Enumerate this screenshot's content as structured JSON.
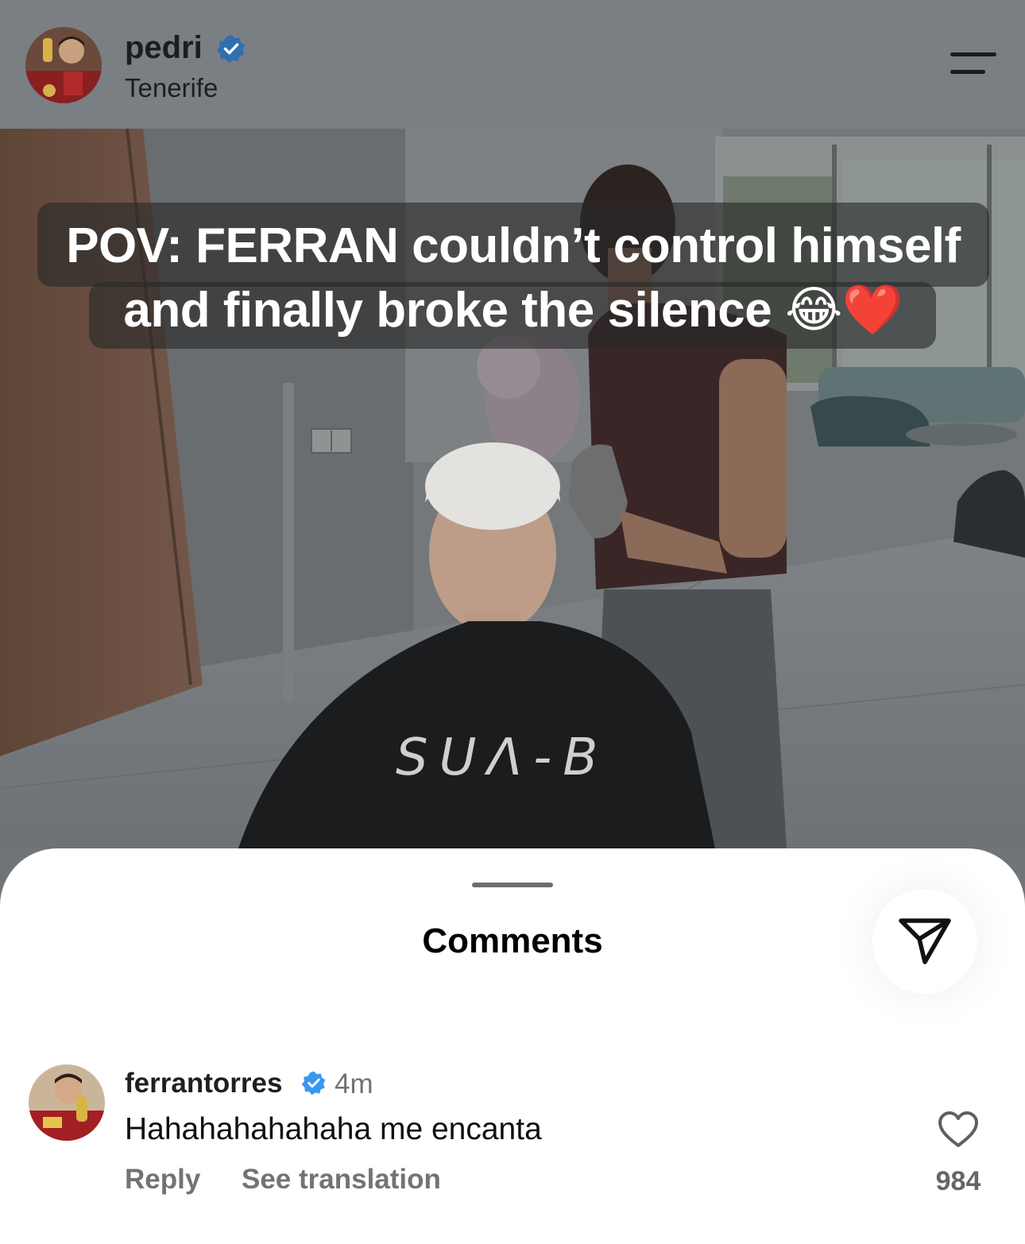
{
  "header": {
    "username": "pedri",
    "location": "Tenerife",
    "avatar_icon": "profile-photo-icon",
    "verified_icon": "verified-badge-icon",
    "menu_icon": "menu-icon"
  },
  "post": {
    "caption_line1": "POV: FERRAN couldn’t control himself",
    "caption_line2": "and finally broke the silence",
    "caption_emojis": "😂❤️",
    "cape_text": "SUΛ-B"
  },
  "comments_sheet": {
    "title": "Comments",
    "share_icon": "send-icon",
    "comments": [
      {
        "username": "ferrantorres",
        "time": "4m",
        "text": "Hahahahahahaha me encanta",
        "reply_label": "Reply",
        "translate_label": "See translation",
        "like_count": "984",
        "like_icon": "heart-outline-icon"
      }
    ]
  },
  "colors": {
    "verified_blue": "#3897f0",
    "overlay_gray": "#7a7f83",
    "muted_text": "#737373"
  }
}
